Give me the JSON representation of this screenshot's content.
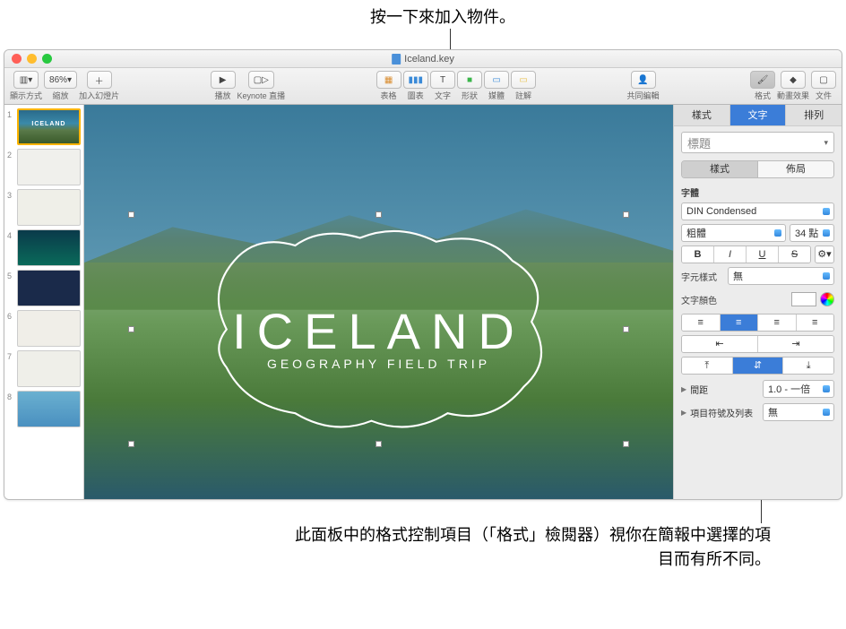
{
  "callouts": {
    "top": "按一下來加入物件。",
    "bottom": "此面板中的格式控制項目（「格式」檢閱器）視你在簡報中選擇的項目而有所不同。"
  },
  "window": {
    "title": "Iceland.key"
  },
  "toolbar": {
    "view_label": "顯示方式",
    "zoom_value": "86%",
    "zoom_label": "縮放",
    "add_slide_label": "加入幻燈片",
    "play_label": "播放",
    "keynote_live_label": "Keynote 直播",
    "table_label": "表格",
    "chart_label": "圖表",
    "text_label": "文字",
    "shape_label": "形狀",
    "media_label": "媒體",
    "comment_label": "註解",
    "collaborate_label": "共同編輯",
    "format_label": "格式",
    "animate_label": "動畫效果",
    "document_label": "文件"
  },
  "navigator": {
    "slides": [
      "1",
      "2",
      "3",
      "4",
      "5",
      "6",
      "7",
      "8"
    ]
  },
  "canvas": {
    "title": "ICELAND",
    "subtitle": "GEOGRAPHY FIELD TRIP"
  },
  "inspector": {
    "tabs": {
      "style": "樣式",
      "text": "文字",
      "arrange": "排列"
    },
    "para_style": "標題",
    "seg": {
      "style": "樣式",
      "layout": "佈局"
    },
    "font_section": "字體",
    "font_family": "DIN Condensed",
    "font_weight": "粗體",
    "font_size": "34 點",
    "char_style_label": "字元樣式",
    "char_style_value": "無",
    "text_color_label": "文字顏色",
    "spacing_label": "間距",
    "spacing_value": "1.0 - 一倍",
    "bullets_label": "項目符號及列表",
    "bullets_value": "無",
    "bold": "B",
    "italic": "I",
    "underline": "U",
    "strike": "S"
  }
}
